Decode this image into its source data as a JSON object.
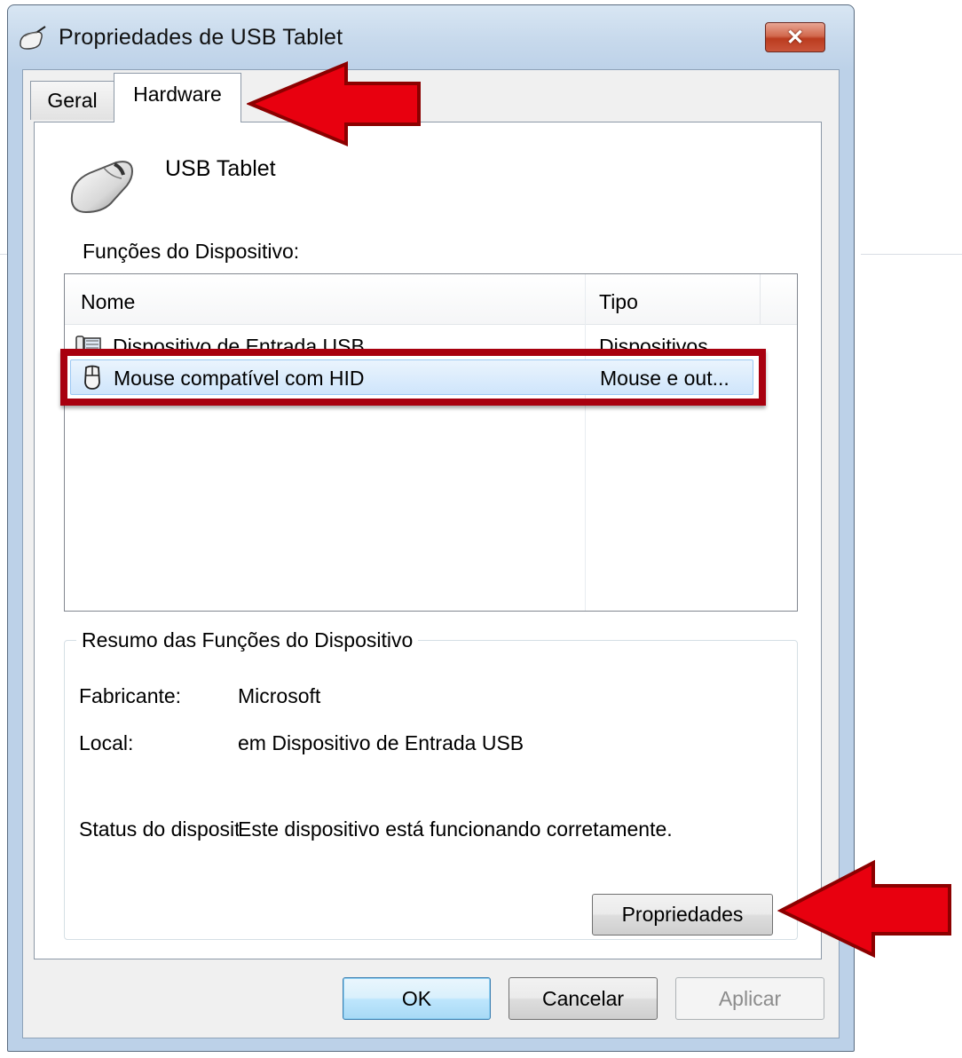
{
  "window": {
    "title": "Propriedades de USB Tablet",
    "close_symbol": "✕"
  },
  "tabs": [
    {
      "label": "Geral",
      "selected": false
    },
    {
      "label": "Hardware",
      "selected": true
    }
  ],
  "device": {
    "name": "USB Tablet",
    "icon": "mouse-icon"
  },
  "functions": {
    "label": "Funções do Dispositivo:",
    "columns": [
      "Nome",
      "Tipo"
    ],
    "rows": [
      {
        "name": "Dispositivo de Entrada USB",
        "type": "Dispositivos...",
        "icon": "usb-device-icon",
        "selected": false
      },
      {
        "name": "Mouse compatível com HID",
        "type": "Mouse e out...",
        "icon": "mouse-icon",
        "selected": true
      }
    ]
  },
  "summary": {
    "legend": "Resumo das Funções do Dispositivo",
    "manufacturer_label": "Fabricante:",
    "manufacturer_value": "Microsoft",
    "location_label": "Local:",
    "location_value": "em Dispositivo de Entrada USB",
    "status_label": "Status do dispositivo:",
    "status_value": "Este dispositivo está funcionando corretamente.",
    "properties_button": "Propriedades"
  },
  "buttons": {
    "ok": "OK",
    "cancel": "Cancelar",
    "apply": "Aplicar"
  },
  "annotation_color": "#e8000f"
}
